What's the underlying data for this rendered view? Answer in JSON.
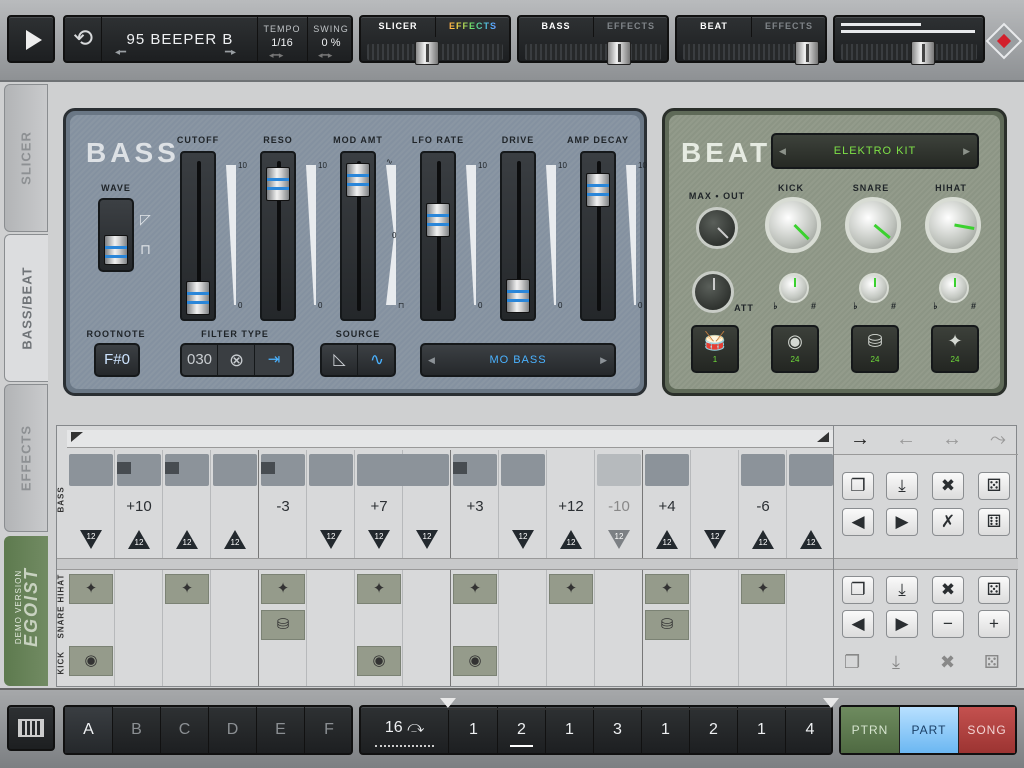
{
  "transport": {
    "song_name": "95 BEEPER B",
    "tempo_label": "TEMPO",
    "tempo_value": "1/16",
    "swing_label": "SWING",
    "swing_value": "0 %"
  },
  "sections": [
    {
      "left": "SLICER",
      "right": "EFFECTS"
    },
    {
      "left": "BASS",
      "right": "EFFECTS"
    },
    {
      "left": "BEAT",
      "right": "EFFECTS"
    }
  ],
  "side_tabs": [
    "SLICER",
    "BASS/BEAT",
    "EFFECTS"
  ],
  "brand": {
    "demo": "DEMO VERSION",
    "name": "EGOIST"
  },
  "bass": {
    "title": "BASS",
    "wave_label": "WAVE",
    "faders": [
      "CUTOFF",
      "RESO",
      "MOD AMT",
      "LFO RATE",
      "DRIVE",
      "AMP DECAY"
    ],
    "scale_top": "10",
    "scale_bottom": "0",
    "scale_mid": "0",
    "rootnote_label": "ROOTNOTE",
    "rootnote_value": "F#0",
    "filter_type_label": "FILTER TYPE",
    "filter_type_value": "030",
    "source_label": "SOURCE",
    "preset": "MO BASS"
  },
  "beat": {
    "title": "BEAT",
    "kit": "ELEKTRO KIT",
    "maxout_label": "MAX • OUT",
    "att_label": "ATT",
    "knobs": [
      "KICK",
      "SNARE",
      "HIHAT"
    ],
    "flat": "♭",
    "sharp": "#",
    "pads": [
      "1",
      "24",
      "24",
      "24"
    ]
  },
  "sequencer": {
    "bass_row_label": "BASS",
    "drum_row_labels": [
      "HIHAT",
      "SNARE",
      "KICK"
    ],
    "notes": [
      "",
      "+10",
      "",
      "",
      "-3",
      "",
      "+7",
      "",
      "+3",
      "",
      "+12",
      "-10",
      "+4",
      "",
      "-6",
      ""
    ],
    "accent": [
      "12",
      "12",
      "12",
      "12",
      "",
      "12",
      "12",
      "12",
      "",
      "12",
      "12",
      "12",
      "12",
      "12",
      "12",
      "12"
    ],
    "direction_icons": [
      "→",
      "←",
      "↔",
      "⤳"
    ]
  },
  "bottom": {
    "patterns": [
      "A",
      "B",
      "C",
      "D",
      "E",
      "F"
    ],
    "step_count": "16",
    "counts": [
      "1",
      "2",
      "1",
      "3",
      "1",
      "2",
      "1",
      "4"
    ],
    "modes": [
      "PTRN",
      "PART",
      "SONG"
    ]
  }
}
